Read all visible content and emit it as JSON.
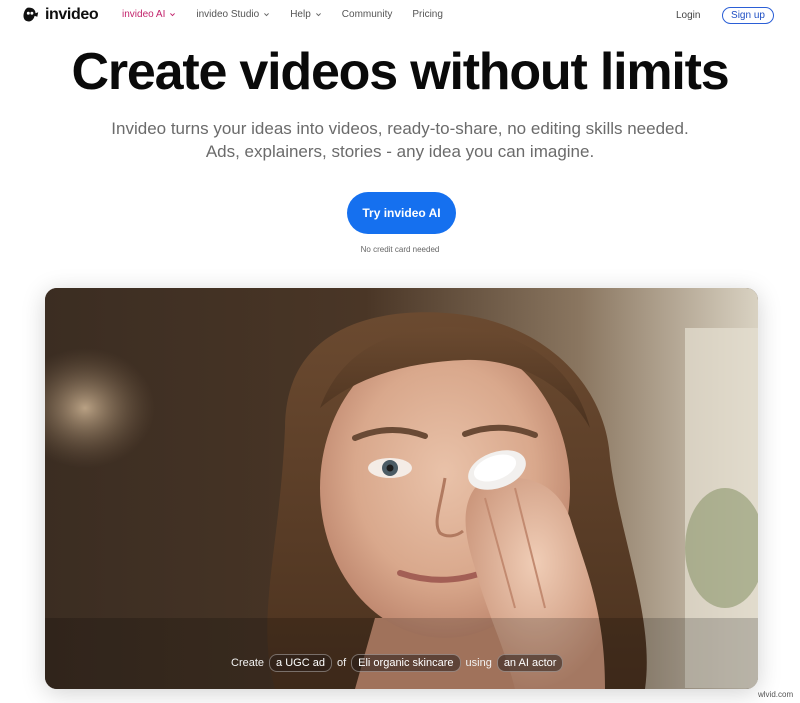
{
  "nav": {
    "logo_text": "invideo",
    "links": [
      {
        "label": "invideo AI",
        "has_dropdown": true,
        "active": true
      },
      {
        "label": "invideo Studio",
        "has_dropdown": true,
        "active": false
      },
      {
        "label": "Help",
        "has_dropdown": true,
        "active": false
      },
      {
        "label": "Community",
        "has_dropdown": false,
        "active": false
      },
      {
        "label": "Pricing",
        "has_dropdown": false,
        "active": false
      }
    ],
    "login_label": "Login",
    "signup_label": "Sign up"
  },
  "hero": {
    "title": "Create videos without limits",
    "subtitle": "Invideo turns your ideas into videos, ready-to-share, no editing skills needed. Ads, explainers, stories - any idea you can imagine.",
    "cta_label": "Try invideo AI",
    "cta_note": "No credit card needed"
  },
  "video": {
    "prompt": {
      "w1": "Create",
      "chip1": "a UGC ad",
      "w2": "of",
      "chip2": "Eli organic skincare",
      "w3": "using",
      "chip3": "an AI actor"
    }
  },
  "watermark": "wlvid.com",
  "colors": {
    "accent_active": "#c3246c",
    "cta_blue": "#1570ef",
    "signup_border": "#2b5fd6"
  },
  "icons": [
    "invideo-logo-icon",
    "chevron-down-icon"
  ]
}
